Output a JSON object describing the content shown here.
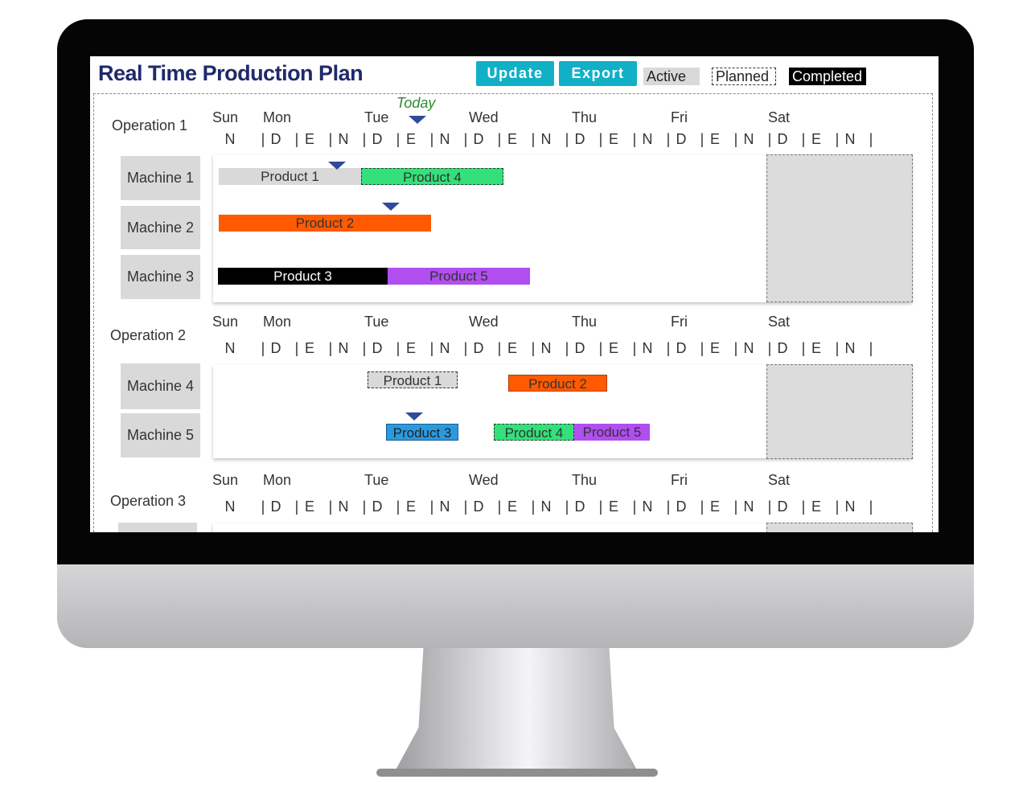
{
  "app": {
    "title": "Real Time Production Plan",
    "update_label": "Update",
    "export_label": "Export"
  },
  "legend": {
    "active": "Active",
    "planned": "Planned",
    "completed": "Completed"
  },
  "today_label": "Today",
  "days": [
    "Sun",
    "Mon",
    "Tue",
    "Wed",
    "Thu",
    "Fri",
    "Sat"
  ],
  "shift_codes": [
    "D",
    "E",
    "N"
  ],
  "operations": [
    {
      "label": "Operation 1",
      "machines": [
        {
          "label": "Machine 1",
          "bars": [
            {
              "label": "Product 1",
              "status": "active"
            },
            {
              "label": "Product 4",
              "status": "planned"
            }
          ]
        },
        {
          "label": "Machine 2",
          "bars": [
            {
              "label": "Product 2",
              "status": "active"
            }
          ]
        },
        {
          "label": "Machine 3",
          "bars": [
            {
              "label": "Product 3",
              "status": "completed"
            },
            {
              "label": "Product 5",
              "status": "active"
            }
          ]
        }
      ]
    },
    {
      "label": "Operation 2",
      "machines": [
        {
          "label": "Machine 4",
          "bars": [
            {
              "label": "Product 1",
              "status": "planned"
            },
            {
              "label": "Product 2",
              "status": "active"
            }
          ]
        },
        {
          "label": "Machine 5",
          "bars": [
            {
              "label": "Product 3",
              "status": "active"
            },
            {
              "label": "Product 4",
              "status": "planned"
            },
            {
              "label": "Product 5",
              "status": "active"
            }
          ]
        }
      ]
    },
    {
      "label": "Operation 3",
      "machines": []
    }
  ],
  "colors": {
    "accent": "#12b0c6",
    "title": "#1f2a6b",
    "product_gray": "#d9d9d9",
    "product_green": "#33e07a",
    "product_orange": "#ff5a00",
    "product_black": "#000000",
    "product_purple": "#b14ef0",
    "product_blue": "#2a9ae0",
    "marker": "#2f4b9a",
    "today": "#2e8b2e"
  }
}
